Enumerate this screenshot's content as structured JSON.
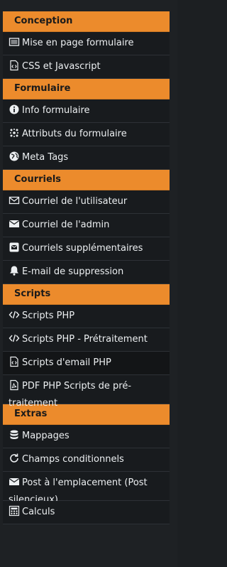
{
  "sections": {
    "conception": {
      "title": "Conception",
      "items": [
        "Mise en page formulaire",
        "CSS et Javascript"
      ]
    },
    "formulaire": {
      "title": "Formulaire",
      "items": [
        "Info formulaire",
        "Attributs du formulaire",
        "Meta Tags"
      ]
    },
    "courriels": {
      "title": "Courriels",
      "items": [
        "Courriel de l'utilisateur",
        "Courriel de l'admin",
        "Courriels supplémentaires",
        "E-mail de suppression"
      ]
    },
    "scripts": {
      "title": "Scripts",
      "items": [
        "Scripts PHP",
        "Scripts PHP - Prétraitement",
        "Scripts d'email PHP",
        "PDF PHP Scripts de pré-traitement"
      ]
    },
    "extras": {
      "title": "Extras",
      "items": [
        "Mappages",
        "Champs conditionnels",
        "Post à l'emplacement (Post silencieux)",
        "Calculs"
      ]
    }
  },
  "colors": {
    "accent": "#ec8b2c",
    "item_bg": "#181b1e",
    "text": "#eceff1"
  },
  "icons": [
    "layout-icon",
    "code-file-icon",
    "info-circle-icon",
    "settings-dots-icon",
    "globe-icon",
    "envelope-outline-icon",
    "envelope-solid-icon",
    "envelope-square-icon",
    "bell-icon",
    "code-icon",
    "code-icon",
    "code-file-icon",
    "pdf-file-icon",
    "database-icon",
    "refresh-icon",
    "envelope-solid-icon",
    "calculator-icon"
  ]
}
